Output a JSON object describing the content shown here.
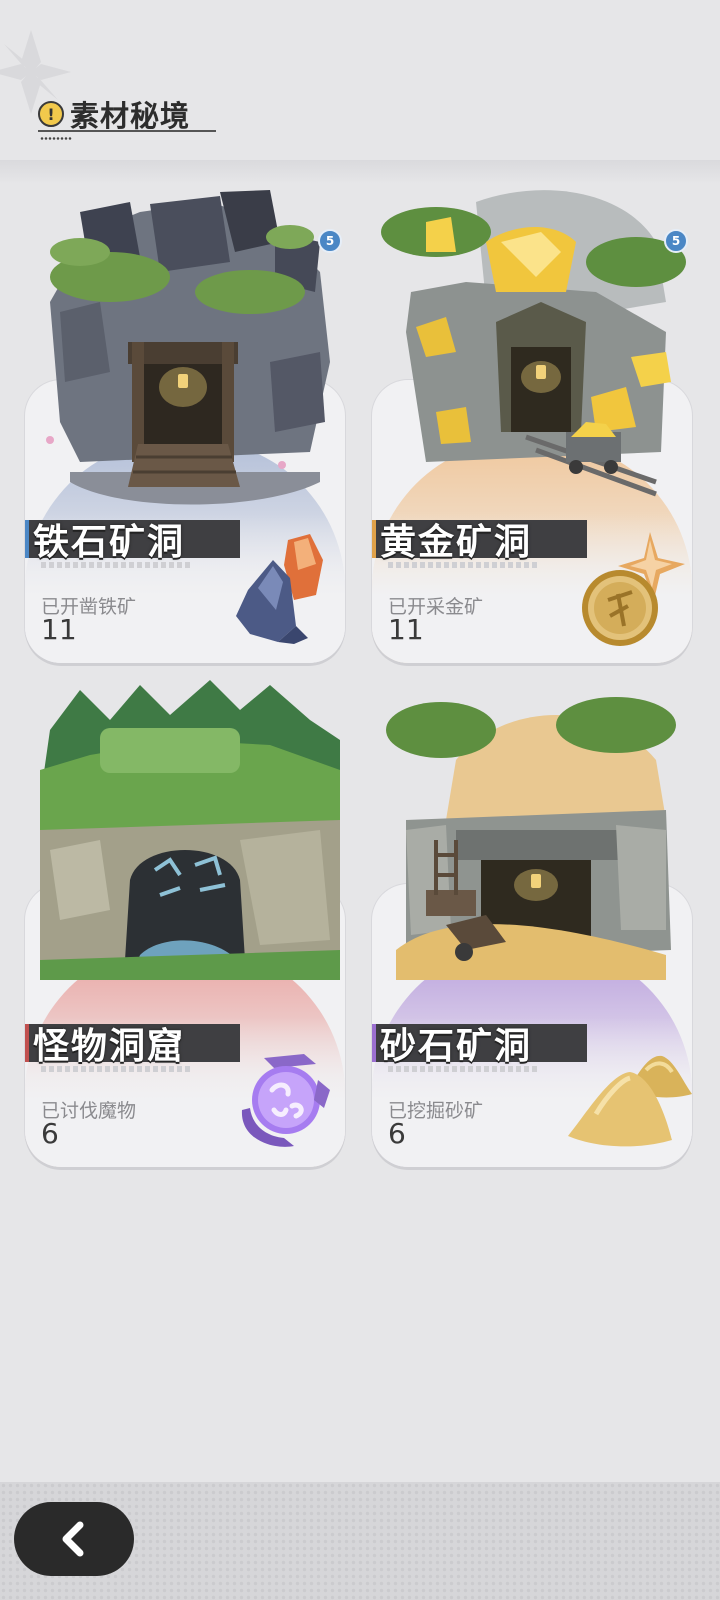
{
  "header": {
    "title": "素材秘境"
  },
  "cards": [
    {
      "name": "铁石矿洞",
      "label": "已开凿铁矿",
      "count": "11",
      "badge": "5",
      "accent": "#4b87c5",
      "sky": "#b3bfd8",
      "item_icon": "iron-crystal-icon"
    },
    {
      "name": "黄金矿洞",
      "label": "已开采金矿",
      "count": "11",
      "badge": "5",
      "accent": "#e0a24a",
      "sky": "#f0c79c",
      "item_icon": "gold-coin-icon"
    },
    {
      "name": "怪物洞窟",
      "label": "已讨伐魔物",
      "count": "6",
      "badge": "",
      "accent": "#c0504f",
      "sky": "#e9a3a0",
      "item_icon": "purple-orb-icon"
    },
    {
      "name": "砂石矿洞",
      "label": "已挖掘砂矿",
      "count": "6",
      "badge": "",
      "accent": "#9b6fd0",
      "sky": "#b9a0dc",
      "item_icon": "sand-pile-icon"
    }
  ]
}
